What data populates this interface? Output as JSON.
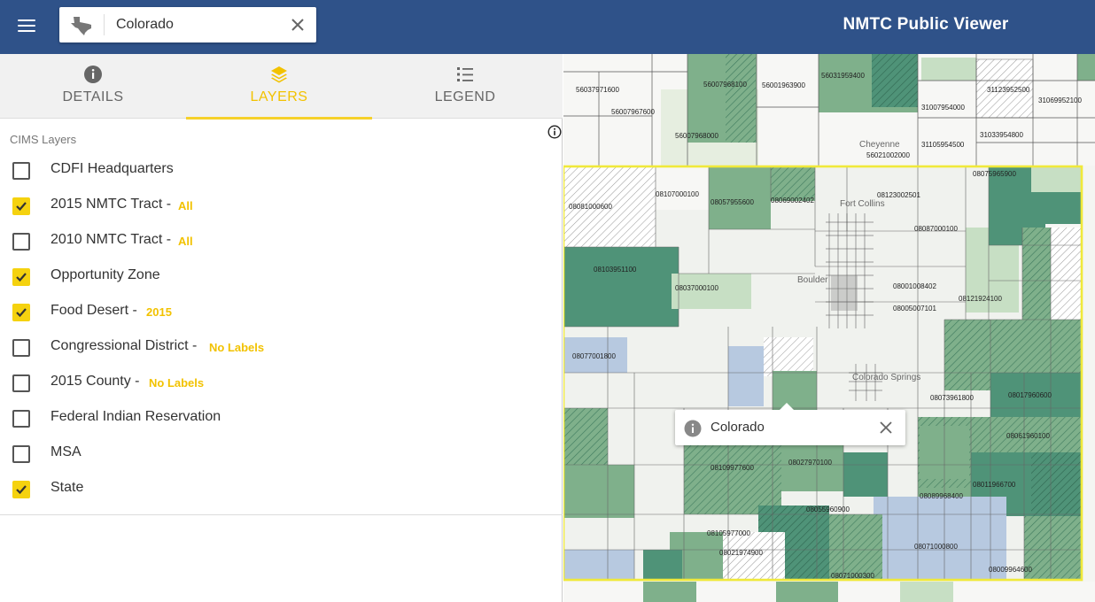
{
  "header": {
    "title": "NMTC Public Viewer",
    "search": {
      "value": "Colorado",
      "placeholder": "Search"
    },
    "icons": {
      "menu": "hamburger-icon",
      "state": "texas-state-icon",
      "clear": "close-icon"
    }
  },
  "tabs": [
    {
      "label": "DETAILS",
      "icon": "info-icon",
      "active": false
    },
    {
      "label": "LAYERS",
      "icon": "layers-icon",
      "active": true
    },
    {
      "label": "LEGEND",
      "icon": "legend-list-icon",
      "active": false
    }
  ],
  "layers": {
    "heading": "CIMS Layers",
    "items": [
      {
        "label": "CDFI Headquarters",
        "checked": false,
        "option": ""
      },
      {
        "label": "2015 NMTC Tract -",
        "checked": true,
        "option": "All"
      },
      {
        "label": "2010 NMTC Tract -",
        "checked": false,
        "option": "All"
      },
      {
        "label": "Opportunity Zone",
        "checked": true,
        "option": ""
      },
      {
        "label": "Food Desert -",
        "checked": true,
        "option": "2015"
      },
      {
        "label": "Congressional District -",
        "checked": false,
        "option": "No Labels"
      },
      {
        "label": "2015 County -",
        "checked": false,
        "option": "No Labels"
      },
      {
        "label": "Federal Indian Reservation",
        "checked": false,
        "option": ""
      },
      {
        "label": "MSA",
        "checked": false,
        "option": ""
      },
      {
        "label": "State",
        "checked": true,
        "option": ""
      }
    ]
  },
  "map": {
    "popup": {
      "text": "Colorado"
    },
    "tract_labels": [
      "56037971600",
      "56007968100",
      "56001963900",
      "56031959400",
      "56007967600",
      "56007968000",
      "31123952500",
      "31069952100",
      "31007954000",
      "31033954800",
      "31105954500",
      "56021002000",
      "08075965900",
      "08107000100",
      "08123002501",
      "08081000600",
      "08057955600",
      "08069002402",
      "08087000100",
      "08103951100",
      "08037000100",
      "08001008402",
      "08121924100",
      "08005007101",
      "08077001800",
      "08073961800",
      "08017960600",
      "08061960100",
      "08109977600",
      "08027970100",
      "08011966700",
      "08089968400",
      "08055960900",
      "08105977000",
      "08021974900",
      "08071000800",
      "08071000300",
      "08009964600"
    ],
    "place_labels": [
      "Cheyenne",
      "Fort Collins",
      "Boulder",
      "Colorado Springs"
    ],
    "colors": {
      "tract_dark": "#4f9378",
      "tract_mid": "#7fb08b",
      "tract_light": "#c7dfc4",
      "food_desert_blue": "#b7c9e0",
      "state_outline": "#f0e93a"
    }
  }
}
